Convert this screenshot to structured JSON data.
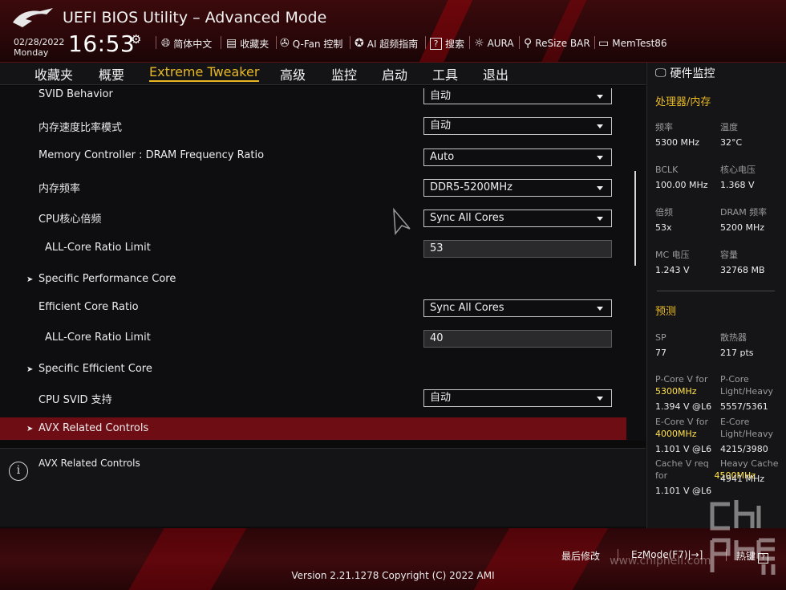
{
  "header": {
    "title": "UEFI BIOS Utility – Advanced Mode",
    "date": "02/28/2022",
    "day": "Monday",
    "time": "16:53",
    "toolbar": [
      {
        "icon": "globe-icon",
        "label": "简体中文"
      },
      {
        "icon": "favorites-icon",
        "label": "收藏夹"
      },
      {
        "icon": "fan-icon",
        "label": "Q-Fan 控制"
      },
      {
        "icon": "ai-oc-icon",
        "label": "AI 超频指南"
      },
      {
        "icon": "help-search-icon",
        "label": "搜索"
      },
      {
        "icon": "aura-icon",
        "label": "AURA"
      },
      {
        "icon": "resize-bar-icon",
        "label": "ReSize BAR"
      },
      {
        "icon": "memtest-icon",
        "label": "MemTest86"
      }
    ]
  },
  "tabs": [
    "收藏夹",
    "概要",
    "Extreme Tweaker",
    "高级",
    "监控",
    "启动",
    "工具",
    "退出"
  ],
  "active_tab": "Extreme Tweaker",
  "settings": [
    {
      "label": "SVID Behavior",
      "type": "dropdown",
      "value": "自动"
    },
    {
      "label": "内存速度比率模式",
      "type": "dropdown",
      "value": "自动"
    },
    {
      "label": "Memory Controller : DRAM Frequency Ratio",
      "type": "dropdown",
      "value": "Auto"
    },
    {
      "label": "内存频率",
      "type": "dropdown",
      "value": "DDR5-5200MHz"
    },
    {
      "label": "CPU核心倍频",
      "type": "dropdown",
      "value": "Sync All Cores"
    },
    {
      "label": "ALL-Core Ratio Limit",
      "type": "text",
      "value": "53"
    },
    {
      "label": "Specific Performance Core",
      "type": "submenu"
    },
    {
      "label": "Efficient Core Ratio",
      "type": "dropdown",
      "value": "Sync All Cores"
    },
    {
      "label": "ALL-Core Ratio Limit",
      "type": "text",
      "value": "40"
    },
    {
      "label": "Specific Efficient Core",
      "type": "submenu"
    },
    {
      "label": "CPU SVID 支持",
      "type": "dropdown",
      "value": "自动"
    },
    {
      "label": "AVX Related Controls",
      "type": "submenu",
      "selected": true
    }
  ],
  "help_text": "AVX Related Controls",
  "monitor": {
    "title": "硬件监控",
    "section_cpu": "处理器/内存",
    "cpu_items": [
      {
        "label": "频率",
        "value": "5300 MHz"
      },
      {
        "label": "温度",
        "value": "32°C"
      },
      {
        "label": "BCLK",
        "value": "100.00 MHz"
      },
      {
        "label": "核心电压",
        "value": "1.368 V"
      },
      {
        "label": "倍频",
        "value": "53x"
      },
      {
        "label": "DRAM 频率",
        "value": "5200 MHz"
      },
      {
        "label": "MC 电压",
        "value": "1.243 V"
      },
      {
        "label": "容量",
        "value": "32768 MB"
      }
    ],
    "section_predict": "预测",
    "sp_label": "SP",
    "sp_value": "77",
    "cooler_label": "散热器",
    "cooler_value": "217 pts",
    "pcore_v_label": "P-Core V for",
    "pcore_v_freq": "5300MHz",
    "pcore_v_value": "1.394 V @L6",
    "pcore_lh_label": "P-Core Light/Heavy",
    "pcore_lh_value": "5557/5361",
    "ecore_v_label": "E-Core V for",
    "ecore_v_freq": "4000MHz",
    "ecore_v_value": "1.101 V @L6",
    "ecore_lh_label": "E-Core Light/Heavy",
    "ecore_lh_value": "4215/3980",
    "cache_v_label": "Cache V req for",
    "cache_v_freq": "4500MHz",
    "cache_v_value": "1.101 V @L6",
    "heavy_cache_label": "Heavy Cache",
    "heavy_cache_value": "4941 MHz"
  },
  "footer": {
    "last_modified": "最后修改",
    "ezmode": "EzMode(F7)|→]",
    "hotkeys": "热键",
    "hotkey_symbol": "?",
    "version": "Version 2.21.1278 Copyright (C) 2022 AMI",
    "watermark_url": "www.chiphell.com"
  },
  "colors": {
    "accent": "#e8b824",
    "selected_row": "#6e0d14",
    "highlight_value": "#ffe14a"
  }
}
